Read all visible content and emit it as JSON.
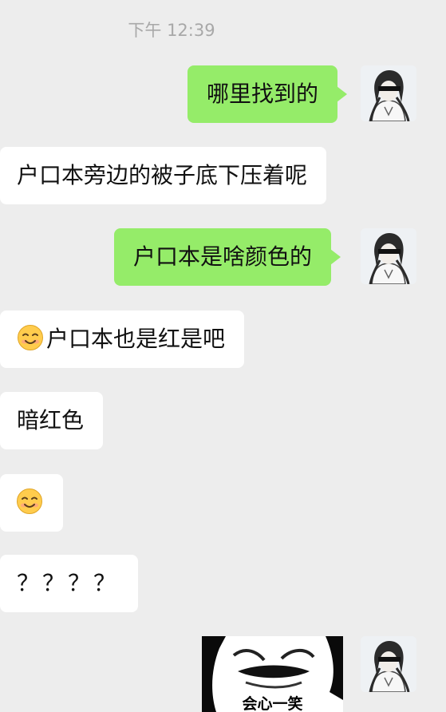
{
  "timestamp": "下午 12:39",
  "messages": [
    {
      "side": "out",
      "text": "哪里找到的"
    },
    {
      "side": "in",
      "text": "户口本旁边的被子底下压着呢"
    },
    {
      "side": "out",
      "text": "户口本是啥颜色的"
    },
    {
      "side": "in",
      "emoji": "smile-emoji",
      "text": "户口本也是红是吧"
    },
    {
      "side": "in",
      "text": "暗红色"
    },
    {
      "side": "in",
      "emoji": "smile-emoji",
      "text": ""
    },
    {
      "side": "in",
      "text": "？？？？"
    },
    {
      "side": "out",
      "sticker": "knowing-smile-sticker",
      "text": "会心一笑"
    }
  ],
  "colors": {
    "background": "#ededed",
    "outgoing_bubble": "#95ec69",
    "incoming_bubble": "#ffffff",
    "timestamp": "#a8a8a8"
  }
}
